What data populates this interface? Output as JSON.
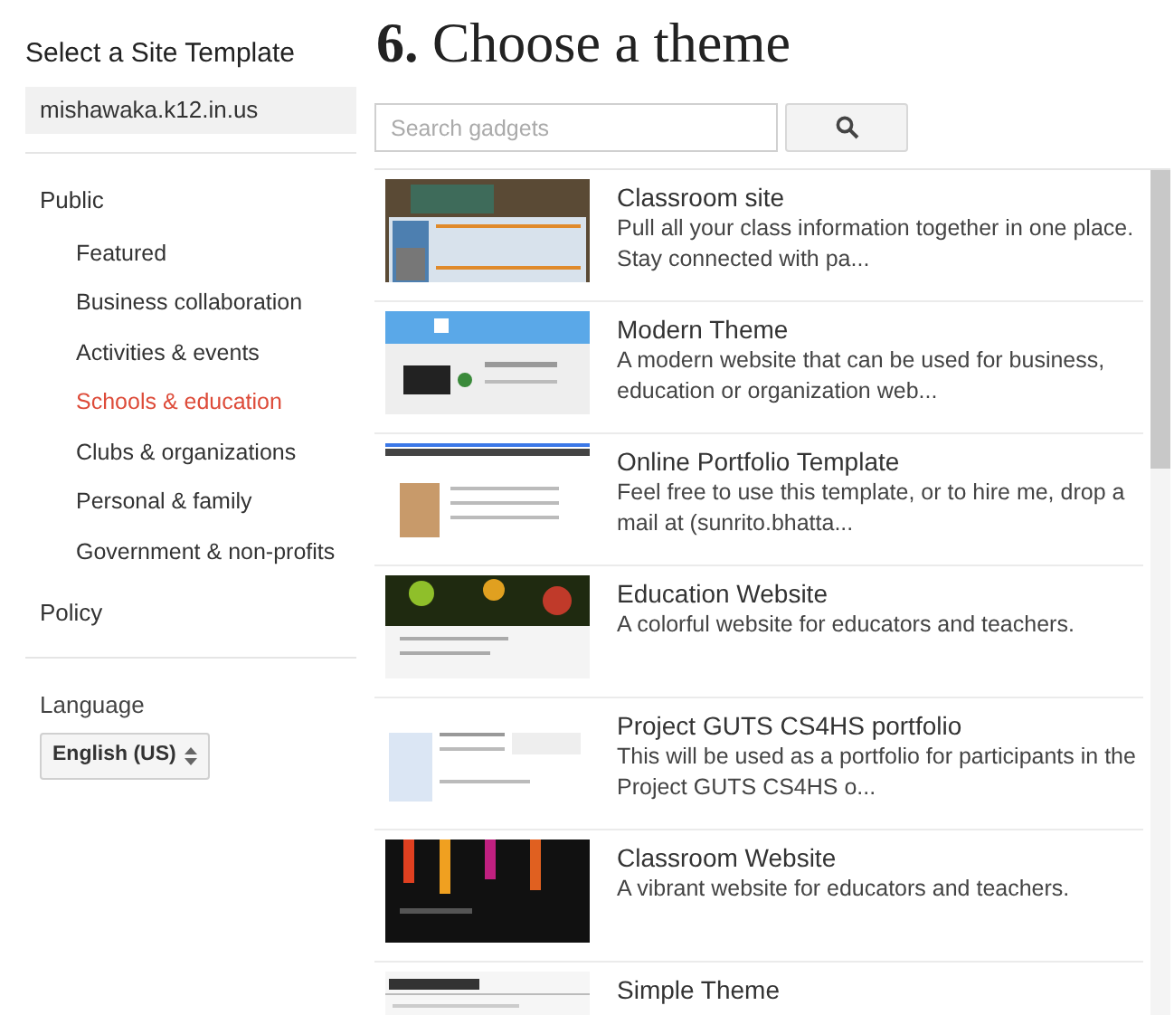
{
  "sidebar": {
    "title": "Select a Site Template",
    "site": "mishawaka.k12.in.us",
    "groups": [
      {
        "label": "Public",
        "items": [
          {
            "label": "Featured",
            "selected": false
          },
          {
            "label": "Business collaboration",
            "selected": false
          },
          {
            "label": "Activities & events",
            "selected": false
          },
          {
            "label": "Schools & education",
            "selected": true
          },
          {
            "label": "Clubs & organizations",
            "selected": false
          },
          {
            "label": "Personal & family",
            "selected": false
          },
          {
            "label": "Government & non-profits",
            "selected": false
          }
        ]
      },
      {
        "label": "Policy"
      }
    ],
    "language": {
      "label": "Language",
      "value": "English (US)"
    }
  },
  "heading": "**6.** Choose a theme",
  "search": {
    "placeholder": "Search gadgets"
  },
  "templates": [
    {
      "title": "Classroom site",
      "description": "Pull all your class information together in one place. Stay connected with pa..."
    },
    {
      "title": "Modern Theme",
      "description": "A modern website that can be used for business, education or organization web..."
    },
    {
      "title": "Online Portfolio Template",
      "description": "Feel free to use this template, or to hire me, drop a mail at (sunrito.bhatta..."
    },
    {
      "title": "Education Website",
      "description": "A colorful website for educators and teachers."
    },
    {
      "title": "Project GUTS CS4HS portfolio",
      "description": "This will be used as a portfolio for participants in the Project GUTS CS4HS o..."
    },
    {
      "title": "Classroom Website",
      "description": "A vibrant website for educators and teachers."
    },
    {
      "title": "Simple Theme"
    }
  ]
}
